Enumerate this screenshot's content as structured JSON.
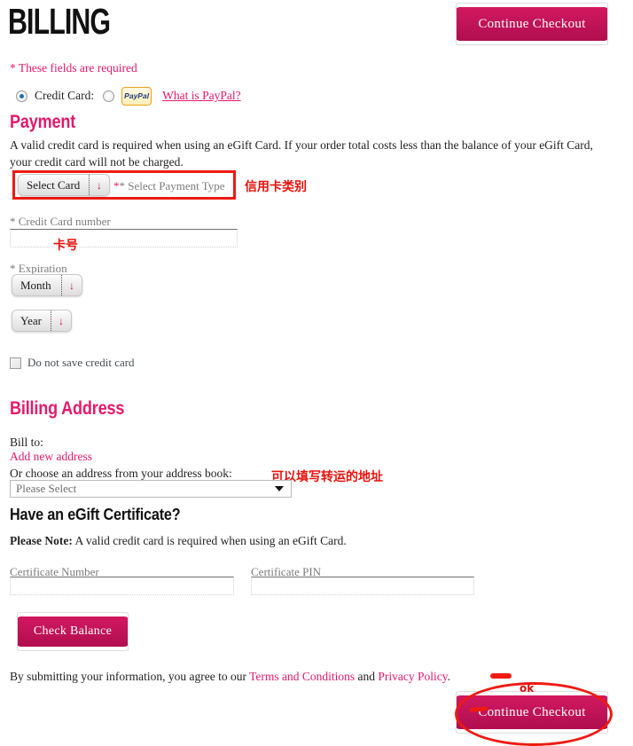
{
  "header": {
    "title": "BILLING",
    "continue_checkout_top": "Continue Checkout",
    "required_note": "* These fields are required"
  },
  "payment_type": {
    "credit_card_label": "Credit Card:",
    "paypal_logo_text": "PayPal",
    "paypal_link": "What is PayPal?",
    "credit_card_selected": true,
    "paypal_selected": false
  },
  "payment": {
    "heading": "Payment",
    "description": "A valid credit card is required when using an eGift Card. If your order total costs less than the balance of your eGift Card, your credit card will not be charged.",
    "card_type_select_value": "Select Card",
    "card_type_required_label": "* Select Payment Type",
    "card_number_label": "* Credit Card number",
    "card_number_value": "",
    "expiration_label": "* Expiration",
    "month_select_value": "Month",
    "year_select_value": "Year",
    "do_not_save_label": "Do not save credit card",
    "do_not_save_checked": false
  },
  "billing_address": {
    "heading": "Billing Address",
    "bill_to_label": "Bill to:",
    "add_new_address_link": "Add new address",
    "address_book_label": "Or choose an address from your address book:",
    "address_book_value": "Please Select"
  },
  "egift": {
    "heading": "Have an eGift Certificate?",
    "note_strong": "Please Note:",
    "note_rest": " A valid credit card is required when using an eGift Card.",
    "certificate_number_label": "Certificate Number",
    "certificate_number_value": "",
    "certificate_pin_label": "Certificate PIN",
    "certificate_pin_value": "",
    "check_balance_button": "Check Balance"
  },
  "footer": {
    "text_start": "By submitting your information, you agree to our ",
    "terms_link": "Terms and Conditions",
    "text_mid": " and ",
    "privacy_link": "Privacy Policy",
    "text_end": ".",
    "continue_checkout_bottom": "Continue Checkout"
  },
  "annotations": {
    "card_type": "信用卡类别",
    "card_number": "卡号",
    "address": "可以填写转运的地址",
    "ok": "ok"
  },
  "colors": {
    "brand_pink": "#e5196a",
    "button_pink": "#c2145a",
    "annotation_red": "#ee1b12",
    "label_gray": "#7b7b7b"
  }
}
